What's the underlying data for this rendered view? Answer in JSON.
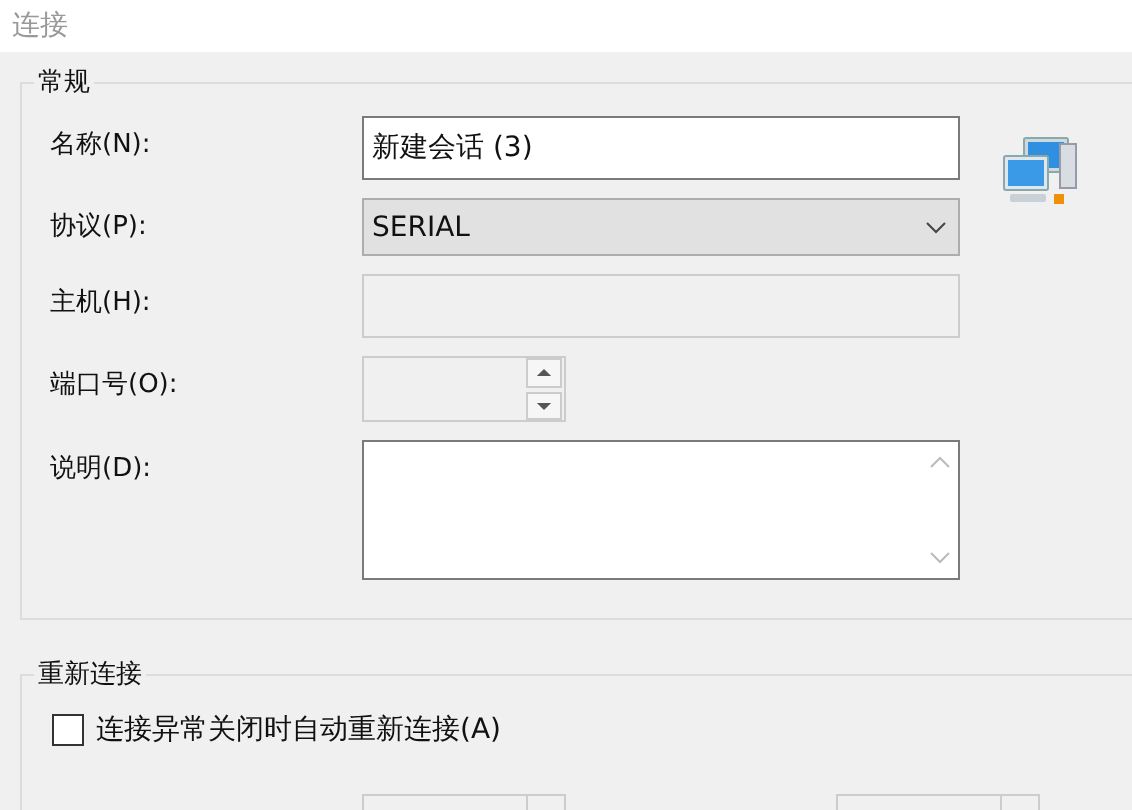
{
  "header": {
    "title": "连接"
  },
  "general": {
    "title": "常规",
    "fields": [
      {
        "kind": "text",
        "label": "名称(N):",
        "value": "新建会话 (3)",
        "disabled": false
      },
      {
        "kind": "select",
        "label": "协议(P):",
        "value": "SERIAL",
        "disabled": false
      },
      {
        "kind": "text",
        "label": "主机(H):",
        "disabled": true
      },
      {
        "kind": "spinner",
        "label": "端口号(O):",
        "disabled": true
      },
      {
        "kind": "textarea",
        "label": "说明(D):",
        "disabled": false
      }
    ]
  },
  "reconnect": {
    "title": "重新连接",
    "checkbox": {
      "label": "连接异常关闭时自动重新连接(A)",
      "checked": false
    },
    "controls": [
      {
        "kind": "spinner",
        "disabled": true
      },
      {
        "kind": "spinner",
        "disabled": true
      }
    ]
  }
}
